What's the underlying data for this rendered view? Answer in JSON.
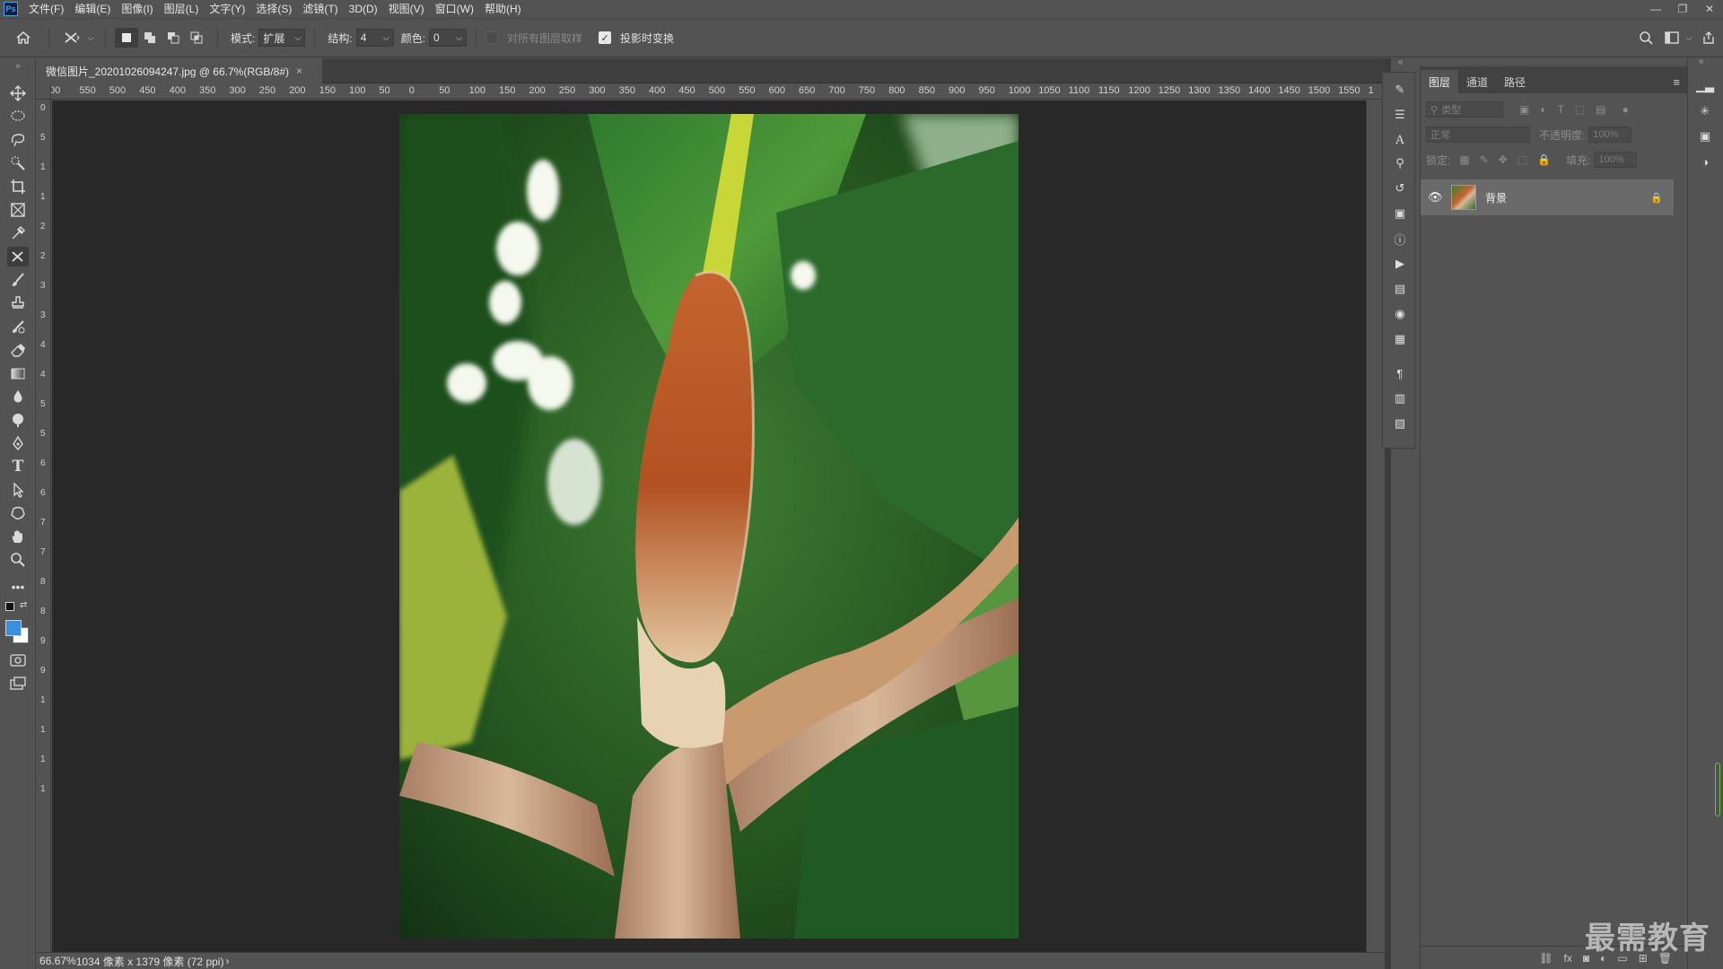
{
  "app": {
    "logo": "Ps"
  },
  "menu": [
    "文件(F)",
    "编辑(E)",
    "图像(I)",
    "图层(L)",
    "文字(Y)",
    "选择(S)",
    "滤镜(T)",
    "3D(D)",
    "视图(V)",
    "窗口(W)",
    "帮助(H)"
  ],
  "options": {
    "mode_label": "模式:",
    "mode_value": "扩展",
    "structure_label": "结构:",
    "structure_value": "4",
    "color_label": "颜色:",
    "color_value": "0",
    "sample_all_layers": "对所有图层取样",
    "transform_on_drop": "投影时变换"
  },
  "document": {
    "tab_title": "微信图片_20201026094247.jpg @ 66.7%(RGB/8#)",
    "close_glyph": "×"
  },
  "ruler": {
    "top_ticks": [
      "00",
      "550",
      "500",
      "450",
      "400",
      "350",
      "300",
      "250",
      "200",
      "150",
      "100",
      "50",
      "0",
      "50",
      "100",
      "150",
      "200",
      "250",
      "300",
      "350",
      "400",
      "450",
      "500",
      "550",
      "600",
      "650",
      "700",
      "750",
      "800",
      "850",
      "900",
      "950",
      "1000",
      "1050",
      "1100",
      "1150",
      "1200",
      "1250",
      "1300",
      "1350",
      "1400",
      "1450",
      "1500",
      "1550",
      "1"
    ],
    "left_ticks": [
      "0",
      "5",
      "1",
      "1",
      "2",
      "2",
      "3",
      "3",
      "4",
      "4",
      "5",
      "5",
      "6",
      "6",
      "7",
      "7",
      "8",
      "8",
      "9",
      "9",
      "1",
      "1",
      "1",
      "1"
    ]
  },
  "status": {
    "zoom": "66.67%",
    "info": "1034 像素 x 1379 像素 (72 ppi)",
    "arrow": "›"
  },
  "layers_panel": {
    "tabs": [
      "图层",
      "通道",
      "路径"
    ],
    "filter_placeholder": "类型",
    "blend_mode": "正常",
    "opacity_label": "不透明度:",
    "opacity_value": "100%",
    "lock_label": "锁定:",
    "fill_label": "填充:",
    "fill_value": "100%",
    "layers": [
      {
        "name": "背景",
        "visible": true,
        "locked": true
      }
    ]
  },
  "watermark": "最需教育",
  "colors": {
    "foreground": "#3a8fe0",
    "background": "#ffffff",
    "accent": "#31a8ff"
  }
}
